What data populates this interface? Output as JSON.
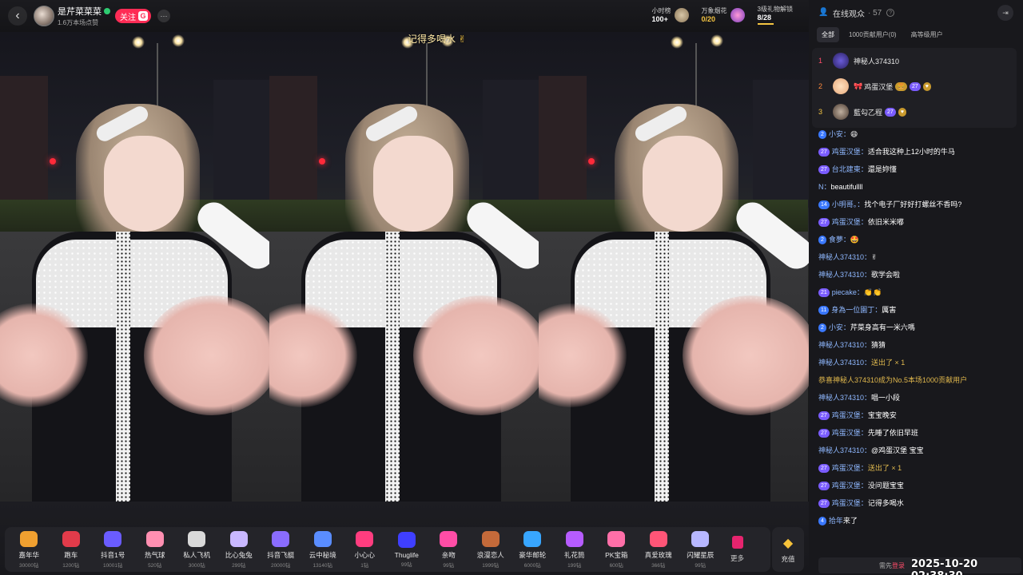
{
  "header": {
    "streamer_name": "是芹菜菜菜",
    "streamer_subtitle": "1.6万本场点赞",
    "follow_label": "关注",
    "follow_badge": "G",
    "more_label": "···",
    "stats": [
      {
        "label": "小时榜",
        "value": "100+"
      },
      {
        "label": "万象烟花",
        "value": "0/20"
      },
      {
        "label": "3级礼物解锁",
        "value": "8/28"
      }
    ]
  },
  "video": {
    "caption": "记得多喝水"
  },
  "gifts": {
    "items": [
      {
        "name": "嘉年华",
        "price": "30000钻",
        "color": "#f0a030"
      },
      {
        "name": "跑车",
        "price": "1200钻",
        "color": "#e23b4a"
      },
      {
        "name": "抖音1号",
        "price": "10001钻",
        "color": "#6a5cff"
      },
      {
        "name": "热气球",
        "price": "520钻",
        "color": "#ff8fb1"
      },
      {
        "name": "私人飞机",
        "price": "3000钻",
        "color": "#d9d9d9"
      },
      {
        "name": "比心兔兔",
        "price": "299钻",
        "color": "#c9b8ff"
      },
      {
        "name": "抖音飞艇",
        "price": "20000钻",
        "color": "#8a6cff"
      },
      {
        "name": "云中秘境",
        "price": "13140钻",
        "color": "#5a8dff"
      },
      {
        "name": "小心心",
        "price": "1钻",
        "color": "#ff3d7f"
      },
      {
        "name": "Thuglife",
        "price": "99钻",
        "color": "#3f3fff"
      },
      {
        "name": "亲吻",
        "price": "99钻",
        "color": "#ff4da6"
      },
      {
        "name": "浪漫恋人",
        "price": "1999钻",
        "color": "#c46a3a"
      },
      {
        "name": "豪华邮轮",
        "price": "6000钻",
        "color": "#38a6ff"
      },
      {
        "name": "礼花筒",
        "price": "199钻",
        "color": "#b65cff"
      },
      {
        "name": "PK宝箱",
        "price": "600钻",
        "color": "#ff6fa8"
      },
      {
        "name": "真爱玫瑰",
        "price": "366钻",
        "color": "#ff5577"
      },
      {
        "name": "闪耀星辰",
        "price": "99钻",
        "color": "#b7b7ff"
      }
    ],
    "more_label": "更多",
    "recharge_label": "充值"
  },
  "sidebar": {
    "title": "在线观众",
    "count": "· 57",
    "tabs": [
      "全部",
      "1000贡献用户(0)",
      "高等级用户"
    ],
    "ranking": [
      {
        "rank": "1",
        "name": "神秘人374310",
        "badges": []
      },
      {
        "rank": "2",
        "name": "鸡蛋汉堡",
        "badges": [
          "27"
        ]
      },
      {
        "rank": "3",
        "name": "藍勾乙程",
        "badges": [
          "27"
        ]
      }
    ]
  },
  "chat": [
    {
      "level": "2",
      "user": "小安：",
      "text": "😄"
    },
    {
      "level": "27",
      "user": "鸡蛋汉堡：",
      "text": "适合我这种上12小时的牛马"
    },
    {
      "level": "27",
      "user": "台北建東：",
      "text": "還是妳懂"
    },
    {
      "level": "",
      "user": "N：",
      "text": "beautifullll"
    },
    {
      "level": "14",
      "user": "小明哥。：",
      "text": "找个电子厂好好打螺丝不香吗?"
    },
    {
      "level": "27",
      "user": "鸡蛋汉堡：",
      "text": "依旧米米嘟"
    },
    {
      "level": "2",
      "user": "食夢：",
      "text": "🤩"
    },
    {
      "level": "",
      "user": "神秘人374310：",
      "text": "✌"
    },
    {
      "level": "",
      "user": "神秘人374310：",
      "text": "歌学会啦"
    },
    {
      "level": "21",
      "user": "piecake：",
      "text": "👏👏"
    },
    {
      "level": "11",
      "user": "身為一位園丁：",
      "text": "厲害"
    },
    {
      "level": "2",
      "user": "小安：",
      "text": "芹菜身高有一米六嗎"
    },
    {
      "level": "",
      "user": "神秘人374310：",
      "text": "猜猜"
    },
    {
      "level": "",
      "user": "神秘人374310：",
      "text": "送出了 × 1"
    },
    {
      "level": "",
      "user": "",
      "text": "恭喜神秘人374310成为No.5本场1000贡献用户"
    },
    {
      "level": "",
      "user": "神秘人374310：",
      "text": "唱一小段"
    },
    {
      "level": "27",
      "user": "鸡蛋汉堡：",
      "text": "宝宝晚安"
    },
    {
      "level": "27",
      "user": "鸡蛋汉堡：",
      "text": "先睡了依旧早班"
    },
    {
      "level": "",
      "user": "神秘人374310：",
      "text": "@鸡蛋汉堡 宝宝"
    },
    {
      "level": "27",
      "user": "鸡蛋汉堡：",
      "text": "送出了 × 1"
    },
    {
      "level": "27",
      "user": "鸡蛋汉堡：",
      "text": "没问题宝宝"
    },
    {
      "level": "27",
      "user": "鸡蛋汉堡：",
      "text": "记得多喝水"
    },
    {
      "level": "4",
      "user": "拾年",
      "text": "来了"
    }
  ],
  "input": {
    "hint": "需先",
    "hint_link": "登录"
  },
  "timestamp": "2025-10-20 02:38:30",
  "colors": {
    "accent": "#fe2c55",
    "gold": "#f5c542",
    "username": "#8fb8ff"
  }
}
